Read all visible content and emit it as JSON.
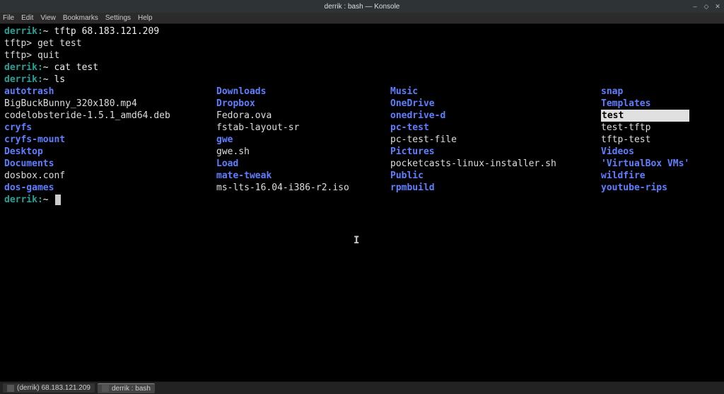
{
  "window": {
    "title": "derrik : bash — Konsole"
  },
  "menubar": [
    "File",
    "Edit",
    "View",
    "Bookmarks",
    "Settings",
    "Help"
  ],
  "terminal": {
    "lines": [
      {
        "prompt": {
          "user": "derrik",
          "path": "~"
        },
        "cmd": "tftp 68.183.121.209"
      },
      {
        "plain": "tftp> get test"
      },
      {
        "plain": "tftp> quit"
      },
      {
        "prompt": {
          "user": "derrik",
          "path": "~"
        },
        "cmd": "cat test"
      },
      {
        "prompt": {
          "user": "derrik",
          "path": "~"
        },
        "cmd": "ls"
      }
    ],
    "ls": {
      "columns": [
        [
          {
            "name": "autotrash",
            "type": "dir"
          },
          {
            "name": "BigBuckBunny_320x180.mp4",
            "type": "file"
          },
          {
            "name": "codelobsteride-1.5.1_amd64.deb",
            "type": "file"
          },
          {
            "name": "cryfs",
            "type": "dir"
          },
          {
            "name": "cryfs-mount",
            "type": "dir"
          },
          {
            "name": "Desktop",
            "type": "dir"
          },
          {
            "name": "Documents",
            "type": "dir"
          },
          {
            "name": "dosbox.conf",
            "type": "file"
          },
          {
            "name": "dos-games",
            "type": "dir"
          }
        ],
        [
          {
            "name": "Downloads",
            "type": "dir"
          },
          {
            "name": "Dropbox",
            "type": "dir"
          },
          {
            "name": "Fedora.ova",
            "type": "file"
          },
          {
            "name": "fstab-layout-sr",
            "type": "file"
          },
          {
            "name": "gwe",
            "type": "dir"
          },
          {
            "name": "gwe.sh",
            "type": "file"
          },
          {
            "name": "Load",
            "type": "dir"
          },
          {
            "name": "mate-tweak",
            "type": "dir"
          },
          {
            "name": "ms-lts-16.04-i386-r2.iso",
            "type": "file"
          }
        ],
        [
          {
            "name": "Music",
            "type": "dir"
          },
          {
            "name": "OneDrive",
            "type": "dir"
          },
          {
            "name": "onedrive-d",
            "type": "dir"
          },
          {
            "name": "pc-test",
            "type": "dir"
          },
          {
            "name": "pc-test-file",
            "type": "file"
          },
          {
            "name": "Pictures",
            "type": "dir"
          },
          {
            "name": "pocketcasts-linux-installer.sh",
            "type": "file"
          },
          {
            "name": "Public",
            "type": "dir"
          },
          {
            "name": "rpmbuild",
            "type": "dir"
          }
        ],
        [
          {
            "name": "snap",
            "type": "dir"
          },
          {
            "name": "Templates",
            "type": "dir"
          },
          {
            "name": "test",
            "type": "highlight"
          },
          {
            "name": "test-tftp",
            "type": "file"
          },
          {
            "name": "tftp-test",
            "type": "file"
          },
          {
            "name": "Videos",
            "type": "dir"
          },
          {
            "name": "'VirtualBox VMs'",
            "type": "dir"
          },
          {
            "name": "wildfire",
            "type": "dir"
          },
          {
            "name": "youtube-rips",
            "type": "dir"
          }
        ]
      ]
    },
    "final_prompt": {
      "user": "derrik",
      "path": "~"
    }
  },
  "taskbar": {
    "items": [
      {
        "label": "(derrik) 68.183.121.209",
        "active": false
      },
      {
        "label": "derrik : bash",
        "active": true
      }
    ]
  }
}
